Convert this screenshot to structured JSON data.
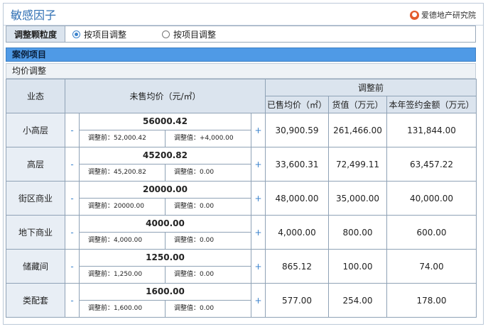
{
  "header": {
    "title": "敏感因子",
    "brand": "爱德地产研究院",
    "brand_icon": "person-pin-icon"
  },
  "granularity": {
    "label": "调整颗粒度",
    "options": [
      "按项目调整",
      "按项目调整"
    ],
    "selected_index": 0
  },
  "section": {
    "title": "案例项目"
  },
  "subsection": {
    "title": "均价调整"
  },
  "table": {
    "col_type": "业态",
    "col_unsold_price": "未售均价（元/㎡）",
    "group_before": "调整前",
    "col_sold_price": "已售均价（㎡）",
    "col_goods_value": "货值（万元）",
    "col_signed_amount": "本年签约金额（万元）",
    "minus_label": "-",
    "plus_label": "+",
    "rows": [
      {
        "type": "小高层",
        "value": "56000.42",
        "before": "调整前：52,000.42",
        "delta": "调整值：+4,000.00",
        "sold_price": "30,900.59",
        "goods_value": "261,466.00",
        "signed": "131,844.00"
      },
      {
        "type": "高层",
        "value": "45200.82",
        "before": "调整前：45,200.82",
        "delta": "调整值：0.00",
        "sold_price": "33,600.31",
        "goods_value": "72,499.11",
        "signed": "63,457.22"
      },
      {
        "type": "街区商业",
        "value": "20000.00",
        "before": "调整前：20000.00",
        "delta": "调整值：0.00",
        "sold_price": "48,000.00",
        "goods_value": "35,000.00",
        "signed": "40,000.00"
      },
      {
        "type": "地下商业",
        "value": "4000.00",
        "before": "调整前：4,000.00",
        "delta": "调整值：0.00",
        "sold_price": "4,000.00",
        "goods_value": "800.00",
        "signed": "600.00"
      },
      {
        "type": "储藏间",
        "value": "1250.00",
        "before": "调整前：1,250.00",
        "delta": "调整值：0.00",
        "sold_price": "865.12",
        "goods_value": "100.00",
        "signed": "74.00"
      },
      {
        "type": "类配套",
        "value": "1600.00",
        "before": "调整前：1,600.00",
        "delta": "调整值：0.00",
        "sold_price": "577.00",
        "goods_value": "254.00",
        "signed": "178.00"
      }
    ]
  }
}
